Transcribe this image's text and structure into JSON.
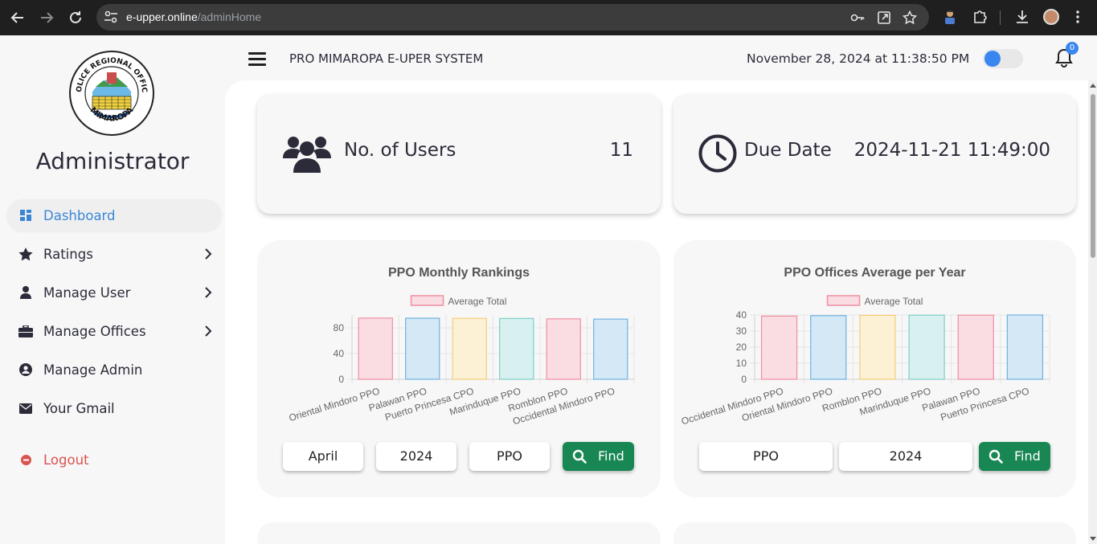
{
  "browser": {
    "url_host": "e-upper.online",
    "url_path": "/adminHome"
  },
  "sidebar": {
    "logo_text_top": "POLICE REGIONAL OFFICE",
    "logo_text_bottom": "MIMAROPA",
    "role_title": "Administrator",
    "items": [
      {
        "label": "Dashboard",
        "icon": "dashboard-icon",
        "active": true
      },
      {
        "label": "Ratings",
        "icon": "star-icon",
        "has_submenu": true
      },
      {
        "label": "Manage User",
        "icon": "user-icon",
        "has_submenu": true
      },
      {
        "label": "Manage Offices",
        "icon": "briefcase-icon",
        "has_submenu": true
      },
      {
        "label": "Manage Admin",
        "icon": "user-circle-icon"
      },
      {
        "label": "Your Gmail",
        "icon": "envelope-icon"
      }
    ],
    "logout_label": "Logout"
  },
  "header": {
    "app_title": "PRO MIMAROPA E-UPER SYSTEM",
    "datetime": "November 28, 2024 at 11:38:50 PM",
    "notification_count": "0"
  },
  "stats": {
    "users_label": "No. of Users",
    "users_value": "11",
    "due_label": "Due Date",
    "due_value": "2024-11-21 11:49:00"
  },
  "monthly": {
    "month": "April",
    "year": "2024",
    "office_type": "PPO",
    "find_label": "Find"
  },
  "yearly": {
    "office_type": "PPO",
    "year": "2024",
    "find_label": "Find"
  },
  "colors": {
    "accent": "#3a86d6",
    "find_green": "#198754",
    "logout_red": "#d9534f"
  },
  "chart_data": [
    {
      "type": "bar",
      "title": "PPO Monthly Rankings",
      "categories": [
        "Oriental Mindoro PPO",
        "Palawan PPO",
        "Puerto Princesa CPO",
        "Marinduque PPO",
        "Romblon PPO",
        "Occidental Mindoro PPO"
      ],
      "series": [
        {
          "name": "Average Total",
          "values": [
            95.2,
            95.0,
            94.8,
            94.6,
            94.0,
            93.6
          ]
        }
      ],
      "ylim": [
        0,
        100
      ],
      "yticks": [
        0,
        40,
        80
      ],
      "bar_fills": [
        "#fadce3",
        "#d4e8f6",
        "#fcf0d5",
        "#d8f0ef",
        "#fadce3",
        "#d4e8f6"
      ],
      "bar_strokes": [
        "#f08fa2",
        "#6fb3e3",
        "#f5cd7a",
        "#7dd0c9",
        "#f08fa2",
        "#6fb3e3"
      ],
      "legend": "top"
    },
    {
      "type": "bar",
      "title": "PPO Offices Average per Year",
      "categories": [
        "Occidental Mindoro PPO",
        "Oriental Mindoro PPO",
        "Romblon PPO",
        "Marinduque PPO",
        "Palawan PPO",
        "Puerto Princesa CPO"
      ],
      "series": [
        {
          "name": "Average Total",
          "values": [
            39.3,
            39.6,
            39.8,
            39.9,
            39.9,
            40.0
          ]
        }
      ],
      "ylim": [
        0,
        40
      ],
      "yticks": [
        0,
        10,
        20,
        30,
        40
      ],
      "bar_fills": [
        "#fadce3",
        "#d4e8f6",
        "#fcf0d5",
        "#d8f0ef",
        "#fadce3",
        "#d4e8f6"
      ],
      "bar_strokes": [
        "#f08fa2",
        "#6fb3e3",
        "#f5cd7a",
        "#7dd0c9",
        "#f08fa2",
        "#6fb3e3"
      ],
      "legend": "top"
    }
  ]
}
